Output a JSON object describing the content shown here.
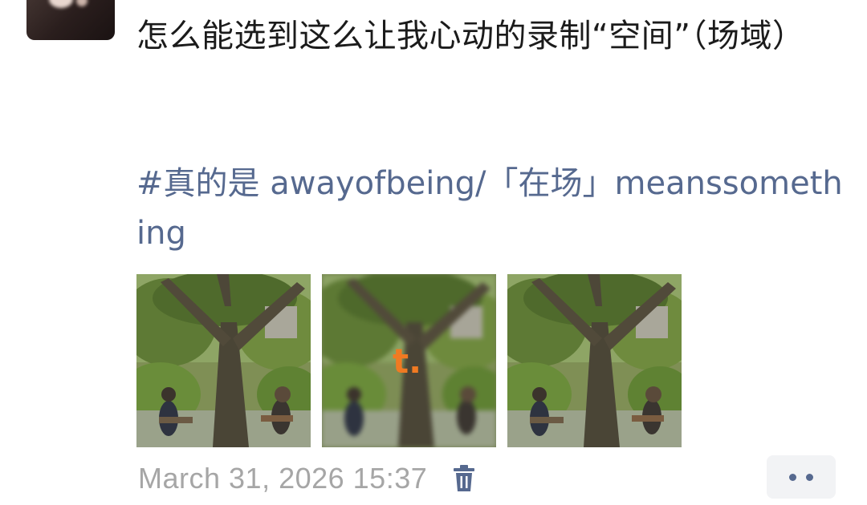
{
  "post": {
    "text": "怎么能选到这么让我心动的录制“空间”（场域）",
    "tag_line": "#真的是 awayofbeing/「在场」meanssomething"
  },
  "images": [
    {
      "name": "photo-1",
      "blurred": false,
      "watermark": ""
    },
    {
      "name": "photo-2",
      "blurred": true,
      "watermark": "t."
    },
    {
      "name": "photo-3",
      "blurred": false,
      "watermark": ""
    }
  ],
  "meta": {
    "timestamp": "March 31, 2026 15:37",
    "delete_icon": "trash-icon",
    "more_icon": "more-dots-icon"
  },
  "colors": {
    "link": "#56698f",
    "timestamp": "#a6a6a6",
    "watermark": "#f07a22"
  }
}
